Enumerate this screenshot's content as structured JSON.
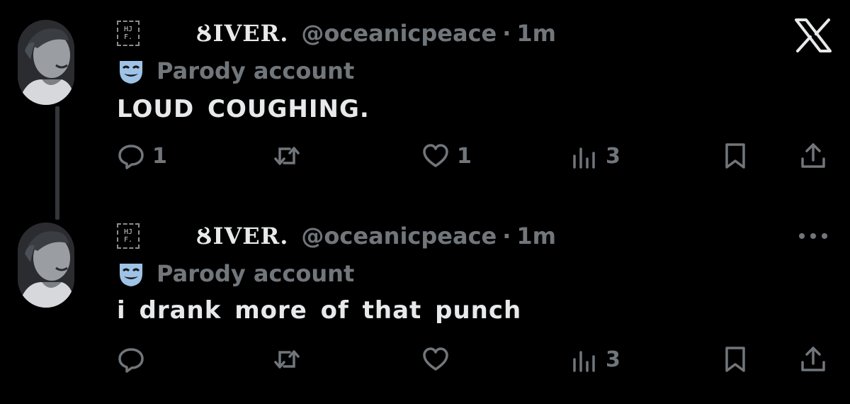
{
  "brand": {
    "logo": "x-logo-icon"
  },
  "tweets": [
    {
      "badge_lines": [
        "HJ",
        "F."
      ],
      "display_name": "ȢIVER.",
      "handle": "@oceanicpeace",
      "separator": "·",
      "time": "1m",
      "parody_label": "Parody account",
      "text": "LOUD COUGHING.",
      "replies": "1",
      "retweets": "",
      "likes": "1",
      "views": "3"
    },
    {
      "badge_lines": [
        "HJ",
        "F."
      ],
      "display_name": "ȢIVER.",
      "handle": "@oceanicpeace",
      "separator": "·",
      "time": "1m",
      "parody_label": "Parody account",
      "text": "i drank more of that punch",
      "replies": "",
      "retweets": "",
      "likes": "",
      "views": "3"
    }
  ],
  "icons": {
    "reply": "reply-icon",
    "retweet": "retweet-icon",
    "like": "heart-icon",
    "views": "views-icon",
    "bookmark": "bookmark-icon",
    "share": "share-icon",
    "more": "more-icon",
    "parody": "mask-icon"
  },
  "colors": {
    "background": "#000000",
    "text": "#e7e9ea",
    "muted": "#71767b",
    "thread_line": "#333639"
  }
}
